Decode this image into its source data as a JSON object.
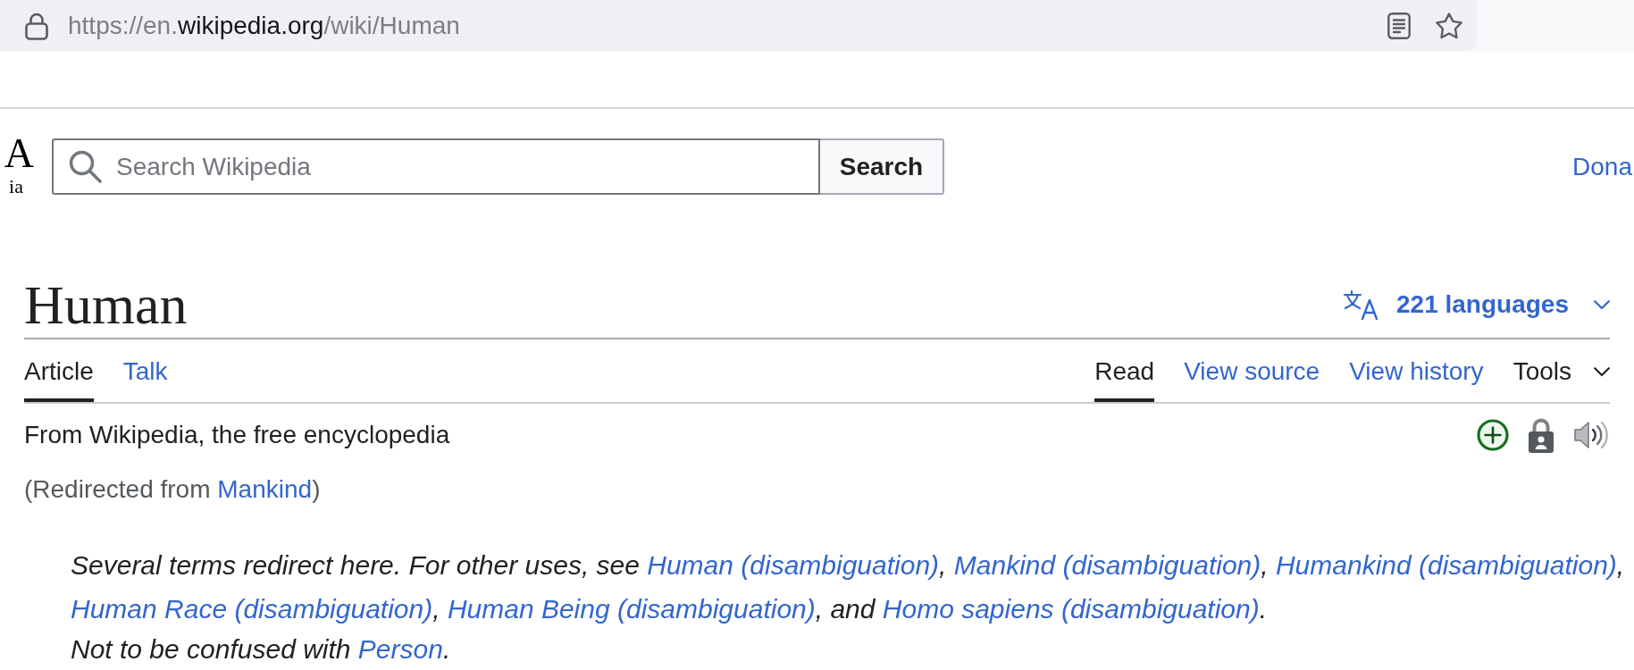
{
  "browser": {
    "url_parts": [
      {
        "text": "https://en.",
        "highlighted": false
      },
      {
        "text": "wikipedia.org",
        "highlighted": true
      },
      {
        "text": "/wiki/Human",
        "highlighted": false
      }
    ]
  },
  "header": {
    "logo_wordmark": "A",
    "logo_tagline": "ia",
    "search": {
      "placeholder": "Search Wikipedia",
      "button": "Search"
    },
    "link": "Dona"
  },
  "article": {
    "title": "Human",
    "languages": "221 languages",
    "tabs_left": [
      {
        "label": "Article",
        "selected": true
      },
      {
        "label": "Talk",
        "selected": false
      }
    ],
    "tabs_right": [
      {
        "label": "Read",
        "selected": true
      },
      {
        "label": "View source",
        "selected": false
      },
      {
        "label": "View history",
        "selected": false
      }
    ],
    "tools": "Tools",
    "tagline": "From Wikipedia, the free encyclopedia",
    "redirect_note": [
      {
        "kind": "text",
        "text": "(Redirected from "
      },
      {
        "kind": "link",
        "text": "Mankind"
      },
      {
        "kind": "text",
        "text": ")"
      }
    ],
    "hatnotes": [
      {
        "parts": [
          {
            "kind": "text",
            "text": "Several terms redirect here. For other uses, see "
          },
          {
            "kind": "link",
            "text": "Human (disambiguation)"
          },
          {
            "kind": "text",
            "text": ", "
          },
          {
            "kind": "link",
            "text": "Mankind (disambiguation)"
          },
          {
            "kind": "text",
            "text": ", "
          },
          {
            "kind": "link",
            "text": "Humankind (disambiguation)"
          },
          {
            "kind": "text",
            "text": ", "
          },
          {
            "kind": "link",
            "text": "Human Race (disambiguation)"
          },
          {
            "kind": "text",
            "text": ", "
          },
          {
            "kind": "link",
            "text": "Human Being (disambiguation)"
          },
          {
            "kind": "text",
            "text": ", and "
          },
          {
            "kind": "link",
            "text": "Homo sapiens (disambiguation)"
          },
          {
            "kind": "text",
            "text": "."
          }
        ]
      },
      {
        "parts": [
          {
            "kind": "text",
            "text": "Not to be confused with "
          },
          {
            "kind": "link",
            "text": "Person"
          },
          {
            "kind": "text",
            "text": "."
          }
        ]
      }
    ]
  }
}
